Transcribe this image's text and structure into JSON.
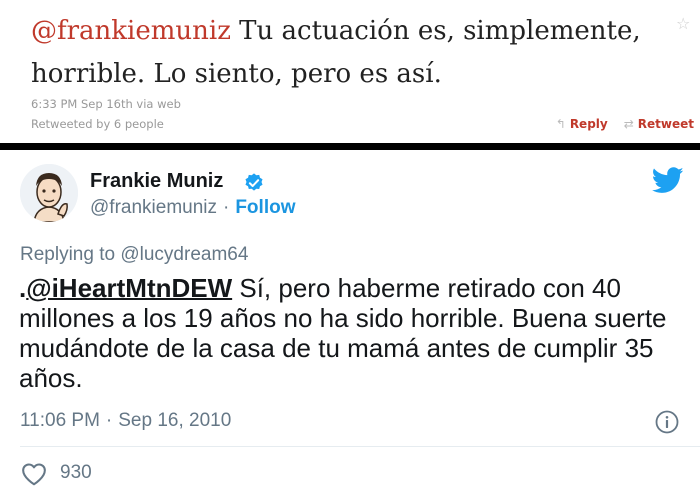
{
  "old_tweet": {
    "mention": "@frankiemuniz",
    "text": " Tu actuación es, simplemente, horrible. Lo siento, pero es así.",
    "meta_time": "6:33 PM Sep 16th via web",
    "retweeted": "Retweeted by 6 people",
    "reply_label": "Reply",
    "retweet_label": "Retweet",
    "star_icon": "star-icon"
  },
  "new_tweet": {
    "author_name": "Frankie Muniz",
    "author_handle": "@frankiemuniz",
    "dot": "·",
    "follow_label": "Follow",
    "reply_prefix": "Replying to",
    "reply_handle": "@lucydream64",
    "body_dot": ".",
    "body_mention": "@iHeartMtnDEW",
    "body_text": " Sí, pero haberme retirado con 40 millones a los 19 años no ha sido horrible. Buena suerte mudándote de la casa de tu mamá antes de cumplir 35 años.",
    "time": "11:06 PM",
    "date_sep": "·",
    "date": "Sep 16, 2010",
    "likes": "930",
    "colors": {
      "accent": "#1b95e0",
      "muted": "#657786",
      "text": "#14171a",
      "old_mention": "#c0392b"
    }
  }
}
